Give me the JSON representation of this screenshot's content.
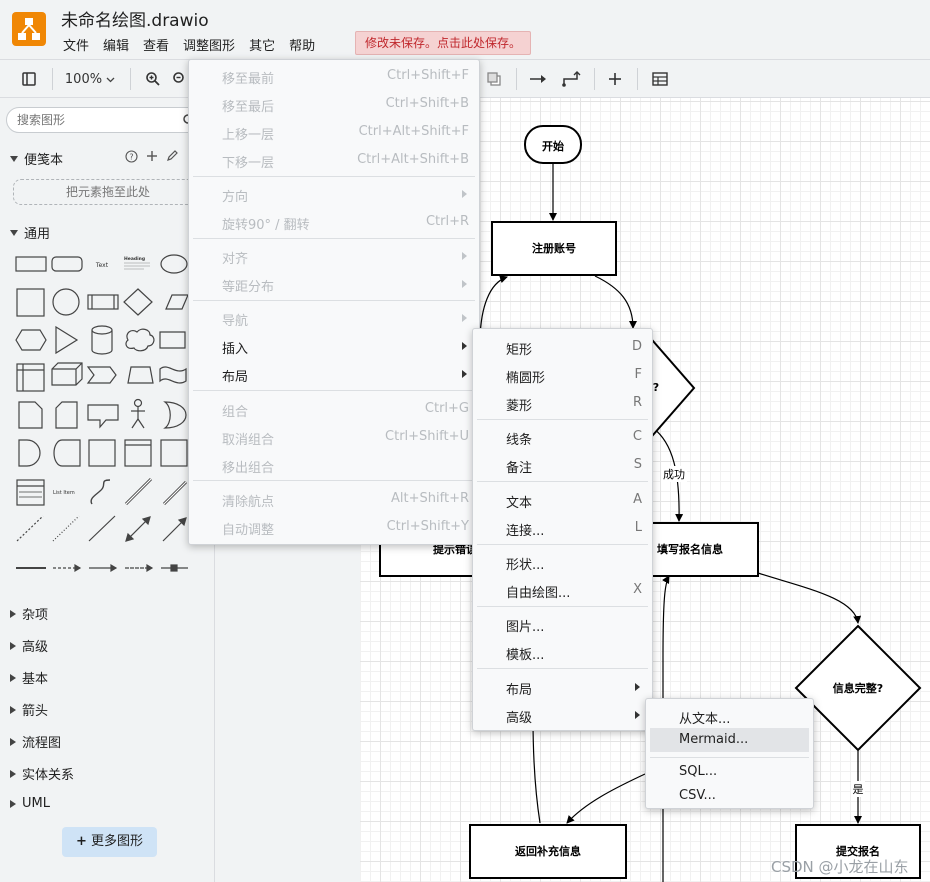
{
  "app": {
    "title": "未命名绘图.drawio",
    "unsaved_notice": "修改未保存。点击此处保存。",
    "brand_color": "#f08705"
  },
  "menubar": [
    "文件",
    "编辑",
    "查看",
    "调整图形",
    "其它",
    "帮助"
  ],
  "toolbar": {
    "zoom": "100%",
    "icons": [
      "format-panel-icon",
      "zoom-in-icon",
      "zoom-out-icon",
      "to-back-icon",
      "connection-icon",
      "waypoint-icon",
      "insert-icon",
      "table-icon"
    ]
  },
  "sidebar": {
    "search_placeholder": "搜索图形",
    "scratchpad_title": "便笺本",
    "scratchpad_drop": "把元素拖至此处",
    "general_title": "通用",
    "general_shape_texts": {
      "text": "Text",
      "heading": "Heading",
      "list": "List Item"
    },
    "collapsed_sections": [
      "杂项",
      "高级",
      "基本",
      "箭头",
      "流程图",
      "实体关系",
      "UML"
    ],
    "more_shapes": "更多图形"
  },
  "diagram": {
    "nodes": {
      "start": "开始",
      "register": "注册账号",
      "decision_cut": "?",
      "error": "提示错误",
      "fill_info": "填写报名信息",
      "complete_q": "信息完整?",
      "return_fill": "返回补充信息",
      "submit": "提交报名"
    },
    "edge_labels": {
      "success": "成功",
      "yes": "是"
    }
  },
  "context_menu": {
    "items": [
      {
        "label": "移至最前",
        "shortcut": "Ctrl+Shift+F",
        "enabled": false
      },
      {
        "label": "移至最后",
        "shortcut": "Ctrl+Shift+B",
        "enabled": false
      },
      {
        "label": "上移一层",
        "shortcut": "Ctrl+Alt+Shift+F",
        "enabled": false
      },
      {
        "label": "下移一层",
        "shortcut": "Ctrl+Alt+Shift+B",
        "enabled": false
      },
      {
        "label": "方向",
        "shortcut": "",
        "enabled": false,
        "submenu": true
      },
      {
        "label": "旋转90° / 翻转",
        "shortcut": "Ctrl+R",
        "enabled": false
      },
      {
        "label": "对齐",
        "shortcut": "",
        "enabled": false,
        "submenu": true
      },
      {
        "label": "等距分布",
        "shortcut": "",
        "enabled": false,
        "submenu": true
      },
      {
        "label": "导航",
        "shortcut": "",
        "enabled": false,
        "submenu": true
      },
      {
        "label": "插入",
        "shortcut": "",
        "enabled": true,
        "submenu": true
      },
      {
        "label": "布局",
        "shortcut": "",
        "enabled": true,
        "submenu": true
      },
      {
        "label": "组合",
        "shortcut": "Ctrl+G",
        "enabled": false
      },
      {
        "label": "取消组合",
        "shortcut": "Ctrl+Shift+U",
        "enabled": false
      },
      {
        "label": "移出组合",
        "shortcut": "",
        "enabled": false
      },
      {
        "label": "清除航点",
        "shortcut": "Alt+Shift+R",
        "enabled": false
      },
      {
        "label": "自动调整",
        "shortcut": "Ctrl+Shift+Y",
        "enabled": false
      }
    ]
  },
  "insert_menu": {
    "items": [
      {
        "label": "矩形",
        "shortcut": "D"
      },
      {
        "label": "椭圆形",
        "shortcut": "F"
      },
      {
        "label": "菱形",
        "shortcut": "R"
      },
      {
        "label": "线条",
        "shortcut": "C"
      },
      {
        "label": "备注",
        "shortcut": "S"
      },
      {
        "label": "文本",
        "shortcut": "A"
      },
      {
        "label": "连接...",
        "shortcut": "L"
      },
      {
        "label": "形状...",
        "shortcut": ""
      },
      {
        "label": "自由绘图...",
        "shortcut": "X"
      },
      {
        "label": "图片...",
        "shortcut": ""
      },
      {
        "label": "模板...",
        "shortcut": ""
      },
      {
        "label": "布局",
        "shortcut": "",
        "submenu": true
      },
      {
        "label": "高级",
        "shortcut": "",
        "submenu": true
      }
    ]
  },
  "advanced_menu": {
    "items": [
      "从文本...",
      "Mermaid...",
      "SQL...",
      "CSV..."
    ],
    "highlighted": "Mermaid..."
  },
  "watermark": "CSDN @小龙在山东"
}
